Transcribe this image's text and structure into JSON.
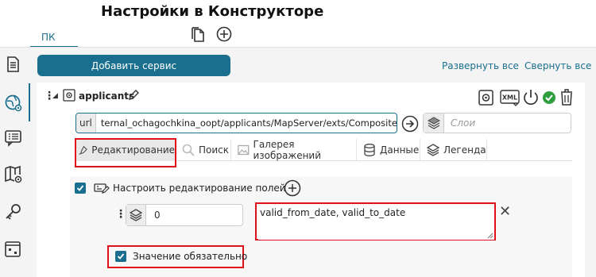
{
  "page": {
    "title": "Настройки в Конструкторе"
  },
  "top_tabs": {
    "pk": "ПК"
  },
  "toolbar": {
    "add_service": "Добавить сервис",
    "expand_all": "Развернуть все",
    "collapse_all": "Свернуть все"
  },
  "service": {
    "name": "applicants",
    "url_prefix": "url",
    "url_value": "ternal_ochagochkina_oopt/applicants/MapServer/exts/CompositeSoe",
    "layers_placeholder": "Слои",
    "xml_badge": "XML"
  },
  "tabs": [
    {
      "label": "Редактирование",
      "icon": "edit-brush-icon"
    },
    {
      "label": "Поиск",
      "icon": "search-icon"
    },
    {
      "label": "Галерея изображений",
      "icon": "image-icon"
    },
    {
      "label": "Данные",
      "icon": "database-icon"
    },
    {
      "label": "Легенда",
      "icon": "layers-icon"
    }
  ],
  "editing": {
    "configure_label": "Настроить редактирование полей",
    "layer_value": "0",
    "fields_value": "valid_from_date, valid_to_date",
    "required_label": "Значение обязательно"
  },
  "colors": {
    "accent": "#1a6f8e",
    "highlight": "#e0101a",
    "success": "#2e9e3e"
  }
}
